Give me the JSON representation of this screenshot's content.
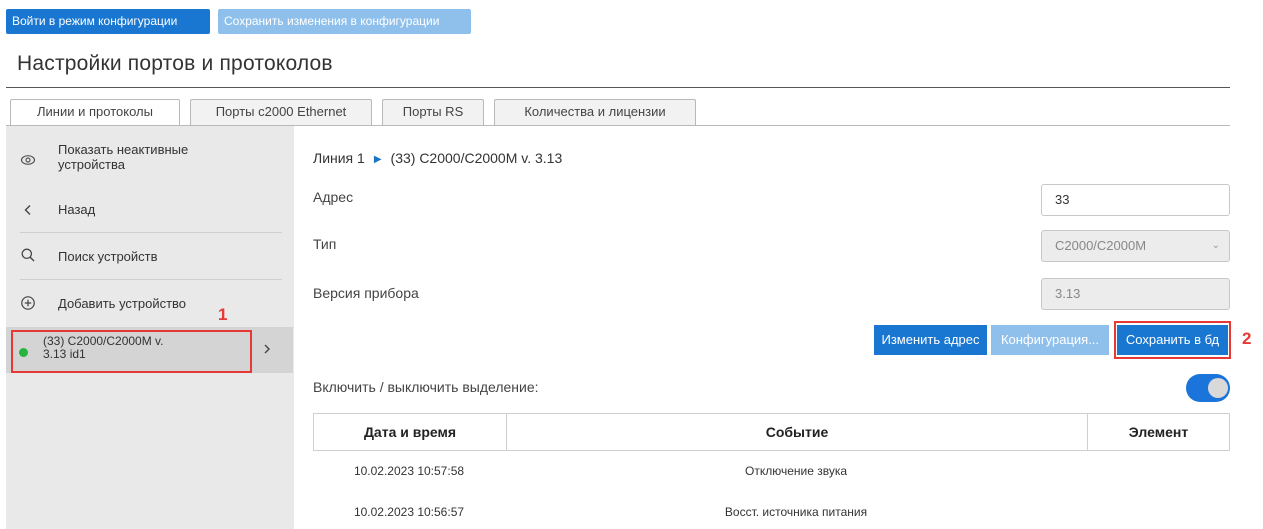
{
  "toolbar": {
    "enter_config_label": "Войти в режим конфигурации",
    "save_config_label": "Сохранить изменения в конфигурации"
  },
  "page_title": "Настройки портов и протоколов",
  "tabs": [
    {
      "label": "Линии и протоколы",
      "active": true
    },
    {
      "label": "Порты с2000 Ethernet",
      "active": false
    },
    {
      "label": "Порты RS",
      "active": false
    },
    {
      "label": "Количества и лицензии",
      "active": false
    }
  ],
  "sidebar": {
    "show_inactive": {
      "icon": "eye-icon",
      "label_line1": "Показать неактивные",
      "label_line2": "устройства"
    },
    "back": {
      "icon": "chevron-left-icon",
      "label": "Назад"
    },
    "search": {
      "icon": "search-icon",
      "label": "Поиск устройств"
    },
    "add": {
      "icon": "plus-circle-icon",
      "label": "Добавить устройство"
    },
    "device": {
      "status_color": "#27b43e",
      "label_line1": "(33) С2000/С2000М v.",
      "label_line2": "3.13 id1",
      "icon": "chevron-right-icon"
    }
  },
  "breadcrumb": {
    "line": "Линия 1",
    "separator_icon": "triangle-right-icon",
    "device": "(33) С2000/С2000М v. 3.13"
  },
  "form": {
    "address": {
      "label": "Адрес",
      "value": "33"
    },
    "type": {
      "label": "Тип",
      "value": "С2000/С2000М",
      "disabled": true
    },
    "version": {
      "label": "Версия прибора",
      "value": "3.13",
      "disabled": true
    }
  },
  "actions": {
    "change_address": "Изменить адрес",
    "configuration": "Конфигурация...",
    "save_db": "Сохранить в бд"
  },
  "toggle": {
    "label": "Включить / выключить выделение:",
    "on": true
  },
  "events_table": {
    "columns": [
      "Дата и время",
      "Событие",
      "Элемент"
    ],
    "rows": [
      {
        "datetime": "10.02.2023 10:57:58",
        "event": "Отключение звука",
        "element": ""
      },
      {
        "datetime": "10.02.2023 10:56:57",
        "event": "Восст. источника питания",
        "element": ""
      }
    ]
  },
  "annotations": [
    "1",
    "2"
  ],
  "colors": {
    "primary": "#1977d2",
    "primary_disabled": "#8fc0ec",
    "annotation": "#e53935"
  }
}
